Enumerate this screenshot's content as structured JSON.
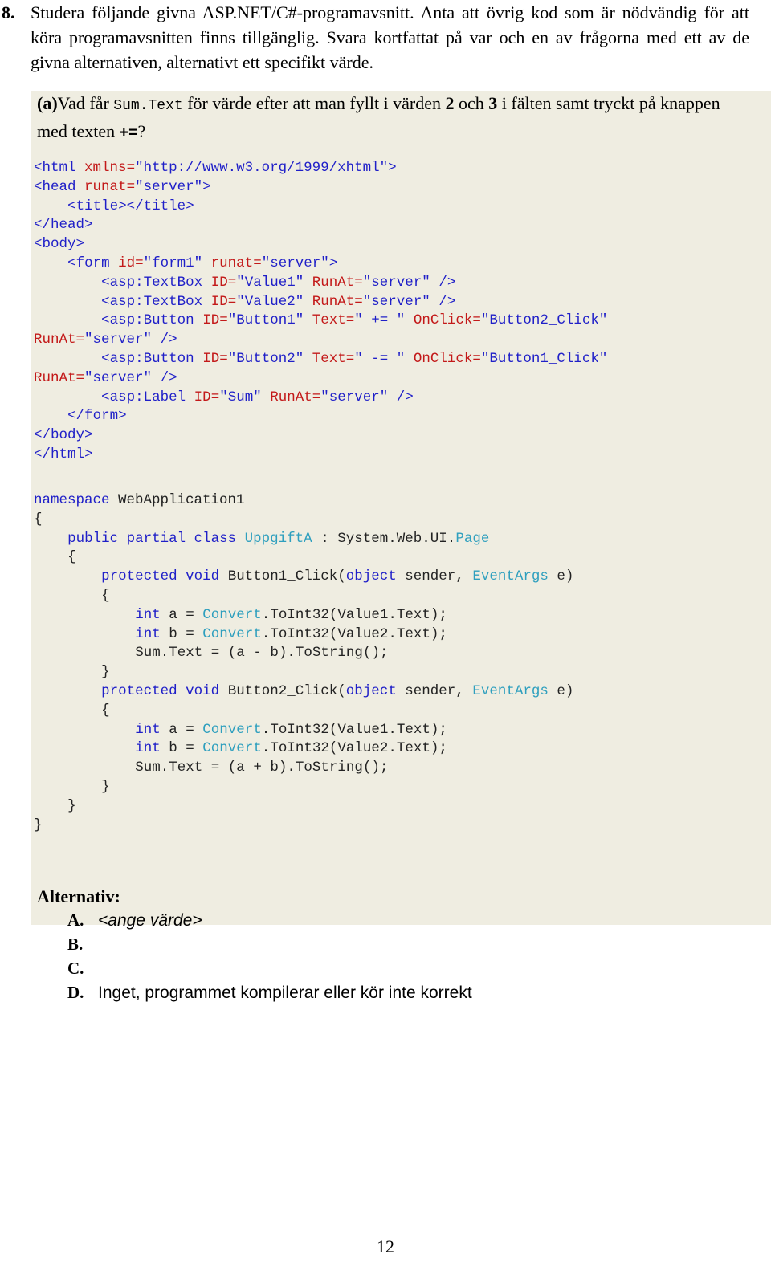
{
  "question": {
    "number": "8.",
    "text": "Studera följande givna ASP.NET/C#-programavsnitt. Anta att övrig kod som är nödvändig för att köra programavsnitten finns tillgänglig. Svara kortfattat på var och en av frågorna med ett av de givna alternativen, alternativt ett specifikt värde."
  },
  "subquestion": {
    "label": "(a)",
    "part1": "Vad får ",
    "code_ref": "Sum.Text",
    "part2": " för värde efter att man fyllt i värden ",
    "value_a": "2",
    "part3": " och ",
    "value_b": "3",
    "part4": " i fälten samt tryckt på knappen med texten ",
    "operator": "+=",
    "part5": "?"
  },
  "markup_code": {
    "language": "aspx",
    "lines": [
      "<html xmlns=\"http://www.w3.org/1999/xhtml\">",
      "<head runat=\"server\">",
      "    <title></title>",
      "</head>",
      "<body>",
      "    <form id=\"form1\" runat=\"server\">",
      "        <asp:TextBox ID=\"Value1\" RunAt=\"server\" />",
      "        <asp:TextBox ID=\"Value2\" RunAt=\"server\" />",
      "        <asp:Button ID=\"Button1\" Text=\" += \" OnClick=\"Button2_Click\"",
      "RunAt=\"server\" />",
      "        <asp:Button ID=\"Button2\" Text=\" -= \" OnClick=\"Button1_Click\"",
      "RunAt=\"server\" />",
      "        <asp:Label ID=\"Sum\" RunAt=\"server\" />",
      "    </form>",
      "</body>",
      "</html>"
    ]
  },
  "csharp_code": {
    "language": "csharp",
    "lines": [
      "namespace WebApplication1",
      "{",
      "    public partial class UppgiftA : System.Web.UI.Page",
      "    {",
      "        protected void Button1_Click(object sender, EventArgs e)",
      "        {",
      "            int a = Convert.ToInt32(Value1.Text);",
      "            int b = Convert.ToInt32(Value2.Text);",
      "            Sum.Text = (a - b).ToString();",
      "        }",
      "        protected void Button2_Click(object sender, EventArgs e)",
      "        {",
      "            int a = Convert.ToInt32(Value1.Text);",
      "            int b = Convert.ToInt32(Value2.Text);",
      "            Sum.Text = (a + b).ToString();",
      "        }",
      "    }",
      "}"
    ]
  },
  "alternatives": {
    "title": "Alternativ:",
    "options": [
      {
        "letter": "A.",
        "text": "<ange värde>",
        "italic": true
      },
      {
        "letter": "B.",
        "text": "",
        "italic": false
      },
      {
        "letter": "C.",
        "text": "",
        "italic": false
      },
      {
        "letter": "D.",
        "text": "Inget, programmet kompilerar eller kör inte korrekt",
        "italic": false
      }
    ]
  },
  "footer": {
    "page_number": "12"
  },
  "colors": {
    "highlight_background": "#efede1",
    "page_background": "#ffffff",
    "markup_tag": "#1f1fc8",
    "markup_attribute": "#c31919",
    "csharp_keyword": "#1f1fc8",
    "csharp_type": "#2e9fbe",
    "text": "#000000"
  }
}
